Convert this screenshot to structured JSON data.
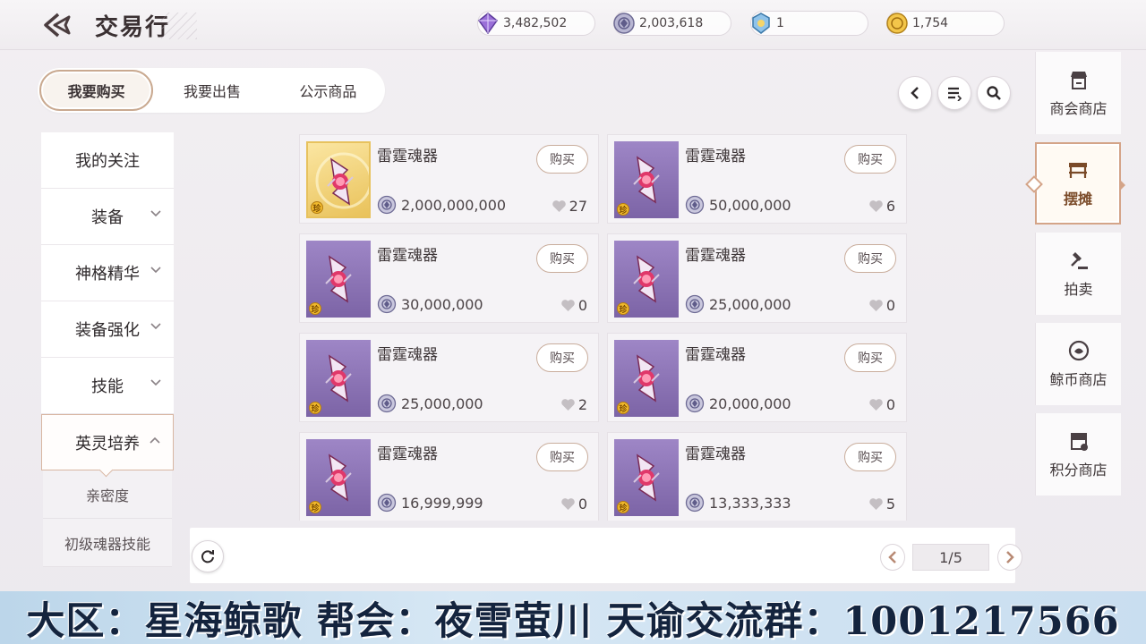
{
  "header": {
    "title": "交易行",
    "currencies": [
      {
        "icon": "purple-crystal-icon",
        "value": "3,482,502"
      },
      {
        "icon": "silver-coin-icon",
        "value": "2,003,618"
      },
      {
        "icon": "blue-badge-icon",
        "value": "1"
      },
      {
        "icon": "gold-coin-icon",
        "value": "1,754"
      }
    ]
  },
  "tabs": [
    {
      "label": "我要购买",
      "active": true
    },
    {
      "label": "我要出售",
      "active": false
    },
    {
      "label": "公示商品",
      "active": false
    }
  ],
  "tools": [
    "back-arrow-icon",
    "filter-list-icon",
    "search-icon"
  ],
  "categories": [
    {
      "label": "我的关注"
    },
    {
      "label": "装备"
    },
    {
      "label": "神格精华"
    },
    {
      "label": "装备强化"
    },
    {
      "label": "技能"
    },
    {
      "label": "英灵培养",
      "expanded": true
    }
  ],
  "subcategories": [
    {
      "label": "亲密度"
    },
    {
      "label": "初级魂器技能"
    }
  ],
  "items": [
    {
      "name": "雷霆魂器",
      "buy_label": "购买",
      "price": "2,000,000,000",
      "likes": "27",
      "rarity": "gold",
      "rare_mark": "珍"
    },
    {
      "name": "雷霆魂器",
      "buy_label": "购买",
      "price": "50,000,000",
      "likes": "6",
      "rarity": "purple",
      "rare_mark": "珍"
    },
    {
      "name": "雷霆魂器",
      "buy_label": "购买",
      "price": "30,000,000",
      "likes": "0",
      "rarity": "purple",
      "rare_mark": "珍"
    },
    {
      "name": "雷霆魂器",
      "buy_label": "购买",
      "price": "25,000,000",
      "likes": "0",
      "rarity": "purple",
      "rare_mark": "珍"
    },
    {
      "name": "雷霆魂器",
      "buy_label": "购买",
      "price": "25,000,000",
      "likes": "2",
      "rarity": "purple",
      "rare_mark": "珍"
    },
    {
      "name": "雷霆魂器",
      "buy_label": "购买",
      "price": "20,000,000",
      "likes": "0",
      "rarity": "purple",
      "rare_mark": "珍"
    },
    {
      "name": "雷霆魂器",
      "buy_label": "购买",
      "price": "16,999,999",
      "likes": "0",
      "rarity": "purple",
      "rare_mark": "珍"
    },
    {
      "name": "雷霆魂器",
      "buy_label": "购买",
      "price": "13,333,333",
      "likes": "5",
      "rarity": "purple",
      "rare_mark": "珍"
    }
  ],
  "pagination": {
    "current": 1,
    "total": 5,
    "display": "1/5"
  },
  "right_nav": [
    {
      "label": "商会商店",
      "icon": "guild-shop-icon",
      "active": false
    },
    {
      "label": "摆摊",
      "icon": "stall-icon",
      "active": true
    },
    {
      "label": "拍卖",
      "icon": "auction-hammer-icon",
      "active": false
    },
    {
      "label": "鲸币商店",
      "icon": "whale-coin-icon",
      "active": false
    },
    {
      "label": "积分商店",
      "icon": "points-shop-icon",
      "active": false
    }
  ],
  "banner": {
    "text": "大区：星海鲸歌 帮会：夜雪萤川 天谕交流群：1001217566"
  },
  "colors": {
    "accent": "#c9a990",
    "card_bg": "#f5f3f6",
    "item_purple": "#8a72b4",
    "item_gold": "#f2d27a"
  }
}
